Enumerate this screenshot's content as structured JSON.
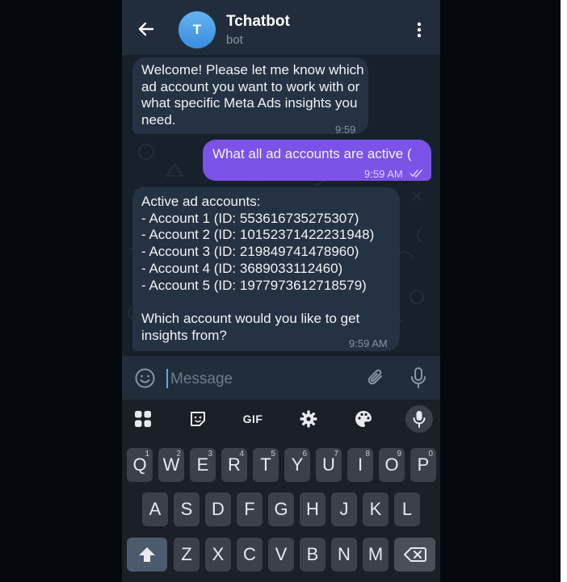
{
  "header": {
    "avatar_letter": "T",
    "title": "Tchatbot",
    "subtitle": "bot"
  },
  "messages": [
    {
      "direction": "incoming",
      "text": "Welcome! Please let me know which\nad account you want to work with or\nwhat specific Meta Ads insights you\nneed.",
      "time": "9:59 AM"
    },
    {
      "direction": "outgoing",
      "text": "What all ad accounts are active (",
      "time": "9:59 AM",
      "status": "read"
    },
    {
      "direction": "incoming",
      "text": "Active ad accounts:\n- Account 1 (ID: 553616735275307)\n- Account 2 (ID: 10152371422231948)\n- Account 3 (ID: 219849741478960)\n- Account 4 (ID: 3689033112460)\n- Account 5 (ID: 1977973612718579)\n\nWhich account would you like to get\ninsights from?",
      "time": "9:59 AM"
    }
  ],
  "composer": {
    "placeholder": "Message"
  },
  "keyboard": {
    "toolbar": [
      "apps-grid-icon",
      "sticker-icon",
      "GIF",
      "settings-gear-icon",
      "palette-icon",
      "microphone-icon"
    ],
    "gif_label": "GIF",
    "row1": [
      {
        "key": "Q",
        "hint": "1"
      },
      {
        "key": "W",
        "hint": "2"
      },
      {
        "key": "E",
        "hint": "3"
      },
      {
        "key": "R",
        "hint": "4"
      },
      {
        "key": "T",
        "hint": "5"
      },
      {
        "key": "Y",
        "hint": "6"
      },
      {
        "key": "U",
        "hint": "7"
      },
      {
        "key": "I",
        "hint": "8"
      },
      {
        "key": "O",
        "hint": "9"
      },
      {
        "key": "P",
        "hint": "0"
      }
    ],
    "row2": [
      "A",
      "S",
      "D",
      "F",
      "G",
      "H",
      "J",
      "K",
      "L"
    ],
    "row3": [
      "Z",
      "X",
      "C",
      "V",
      "B",
      "N",
      "M"
    ]
  },
  "colors": {
    "header_bg": "#212d3b",
    "chat_bg": "#17212b",
    "incoming_bubble": "#253241",
    "outgoing_bubble": "#7b53e6",
    "avatar": "#4a9be6",
    "keyboard_bg": "#1b1f26",
    "key_bg": "#3c4048"
  }
}
